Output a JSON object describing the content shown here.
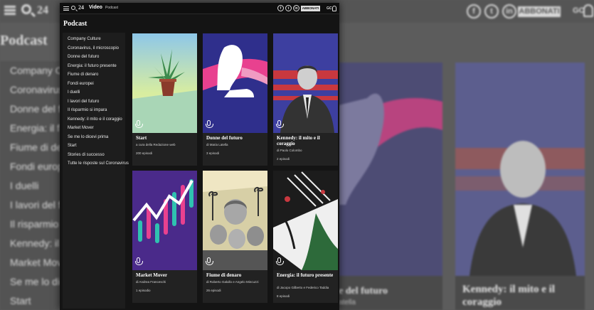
{
  "background": {
    "logo": "24",
    "social": [
      "f",
      "t",
      "in"
    ],
    "subscribe_label": "ABBONATI",
    "user_initials": "GC",
    "page_title": "Podcast",
    "menu_items": [
      "Company C",
      "Coronavirus",
      "Donne del f",
      "Energia: il f",
      "Fiume di de",
      "Fondi europ",
      "I duelli",
      "I lavori del f",
      "Il risparmio",
      "Kennedy: il",
      "Market Mov",
      "Se me lo dic",
      "Start"
    ],
    "card_mid_title": "e del futuro",
    "card_mid_sub": "atella",
    "card_right_title": "Kennedy: il mito e il coraggio"
  },
  "window": {
    "logo": "24",
    "section_label": "Video",
    "nav_label": "Podcast",
    "social": [
      "f",
      "t",
      "in"
    ],
    "subscribe_label": "ABBONATI",
    "user_initials": "GC",
    "page_title": "Podcast",
    "menu_items": [
      "Company Culture",
      "Coronavirus, il microscopio",
      "Donne del futuro",
      "Energia: il futuro presente",
      "Fiume di denaro",
      "Fondi europei",
      "I duelli",
      "I lavori del futuro",
      "Il risparmio si impara",
      "Kennedy: il mito e il coraggio",
      "Market Mover",
      "Se me lo dicevi prima",
      "Start",
      "Stories di successo",
      "Tutte le risposte sul Coronavirus"
    ],
    "cards": [
      {
        "title": "Start",
        "author": "a cura della Redazione web",
        "episodes": "200 episodi"
      },
      {
        "title": "Donne del futuro",
        "author": "di Maria Latella",
        "episodes": "3 episodi"
      },
      {
        "title": "Kennedy: il mito e il coraggio",
        "author": "di Paolo Colombo",
        "episodes": "2 episodi"
      },
      {
        "title": "Market Mover",
        "author": "di Andrea Franceschi",
        "episodes": "1 episodio"
      },
      {
        "title": "Fiume di denaro",
        "author": "di Roberto Galullo e Angelo Mincuzzi",
        "episodes": "26 episodi"
      },
      {
        "title": "Energia: il futuro presente",
        "author": "di Jacopo Gilberto e Federico Taddia",
        "episodes": "8 episodi"
      }
    ]
  },
  "colors": {
    "accent_pink": "#e8418f",
    "navy": "#3d3fa0",
    "purple": "#4a2a8a"
  },
  "icons": [
    "menu-icon",
    "search-icon",
    "facebook-icon",
    "twitter-icon",
    "linkedin-icon",
    "user-icon",
    "microphone-icon"
  ]
}
